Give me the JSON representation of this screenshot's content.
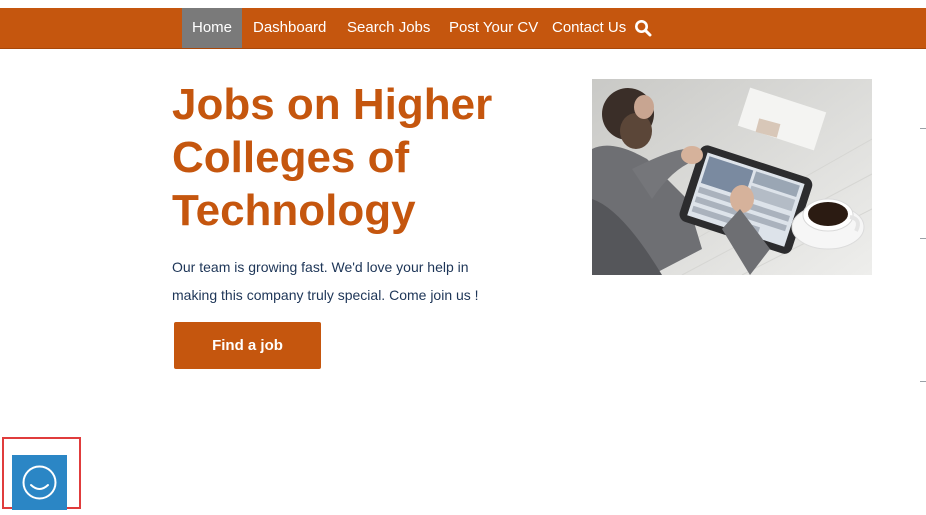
{
  "nav": {
    "items": [
      {
        "label": "Home",
        "active": true
      },
      {
        "label": "Dashboard",
        "active": false
      },
      {
        "label": "Search Jobs",
        "active": false
      },
      {
        "label": "Post Your CV",
        "active": false
      },
      {
        "label": "Contact Us",
        "active": false
      }
    ],
    "search_icon": "search-icon"
  },
  "hero": {
    "title_lines": [
      "Jobs on Higher",
      "Colleges of",
      "Technology"
    ],
    "subtitle_lines": [
      "Our team is growing fast. We'd love your help in",
      "making this company truly special. Come join us !"
    ],
    "button_label": "Find a job",
    "image": "man-using-tablet-with-coffee"
  },
  "chat_widget": {
    "icon": "smiley-chat-icon"
  },
  "colors": {
    "brand": "#c5560e",
    "active_nav": "#7a7a7a",
    "text_dark": "#1d3557",
    "chat_blue": "#2b86c5",
    "highlight": "#e03c3c"
  }
}
